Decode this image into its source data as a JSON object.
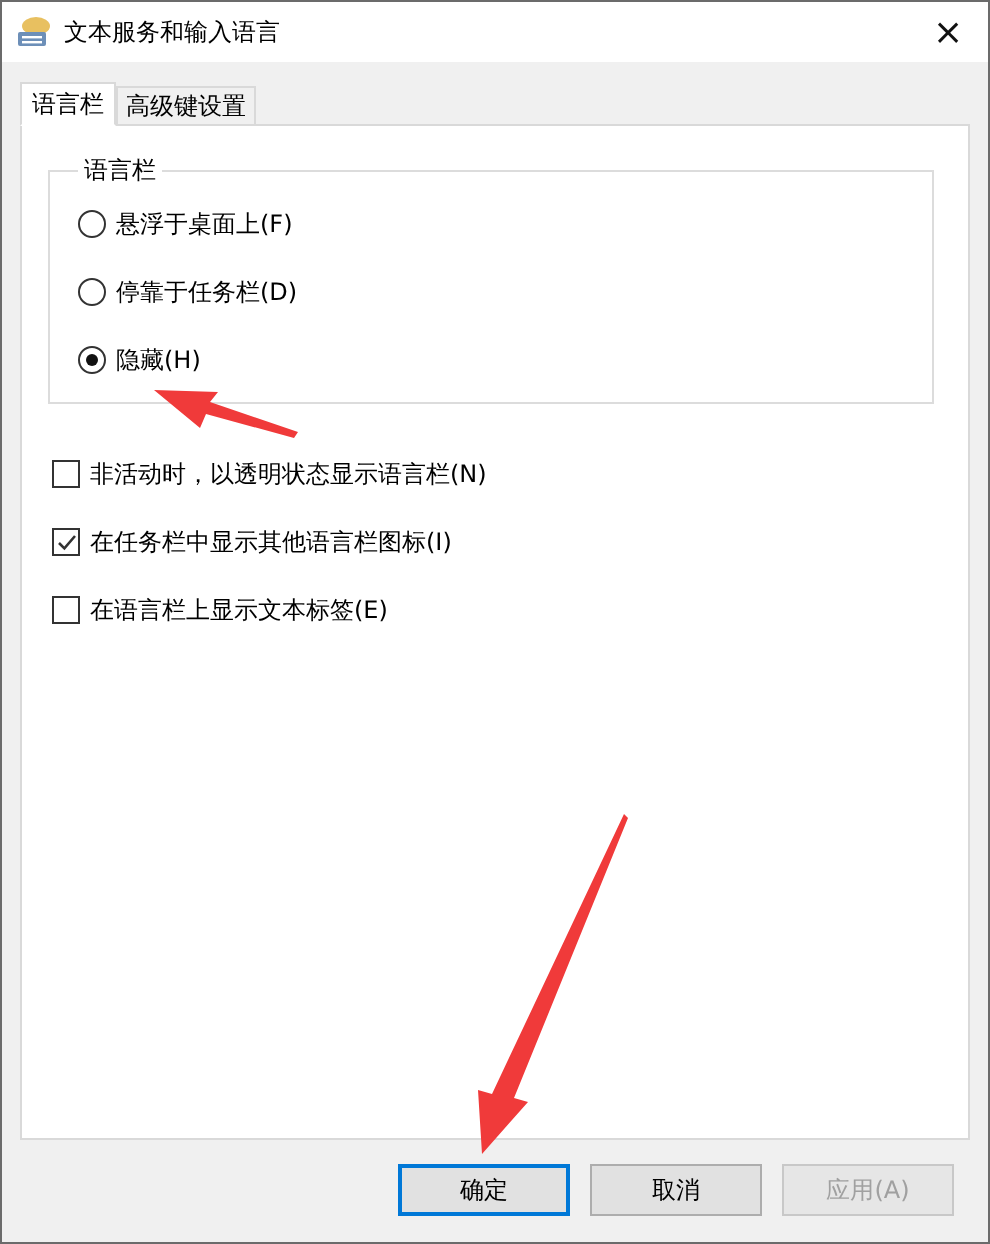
{
  "window": {
    "title": "文本服务和输入语言",
    "close": "×"
  },
  "tabs": [
    {
      "label": "语言栏",
      "selected": true
    },
    {
      "label": "高级键设置",
      "selected": false
    }
  ],
  "group": {
    "title": "语言栏",
    "options": [
      {
        "label": "悬浮于桌面上(F)",
        "selected": false
      },
      {
        "label": "停靠于任务栏(D)",
        "selected": false
      },
      {
        "label": "隐藏(H)",
        "selected": true
      }
    ]
  },
  "checkboxes": [
    {
      "label": "非活动时，以透明状态显示语言栏(N)",
      "checked": false
    },
    {
      "label": "在任务栏中显示其他语言栏图标(I)",
      "checked": true
    },
    {
      "label": "在语言栏上显示文本标签(E)",
      "checked": false
    }
  ],
  "buttons": [
    {
      "label": "确定",
      "focused": true,
      "disabled": false
    },
    {
      "label": "取消",
      "focused": false,
      "disabled": false
    },
    {
      "label": "应用(A)",
      "focused": false,
      "disabled": true
    }
  ]
}
